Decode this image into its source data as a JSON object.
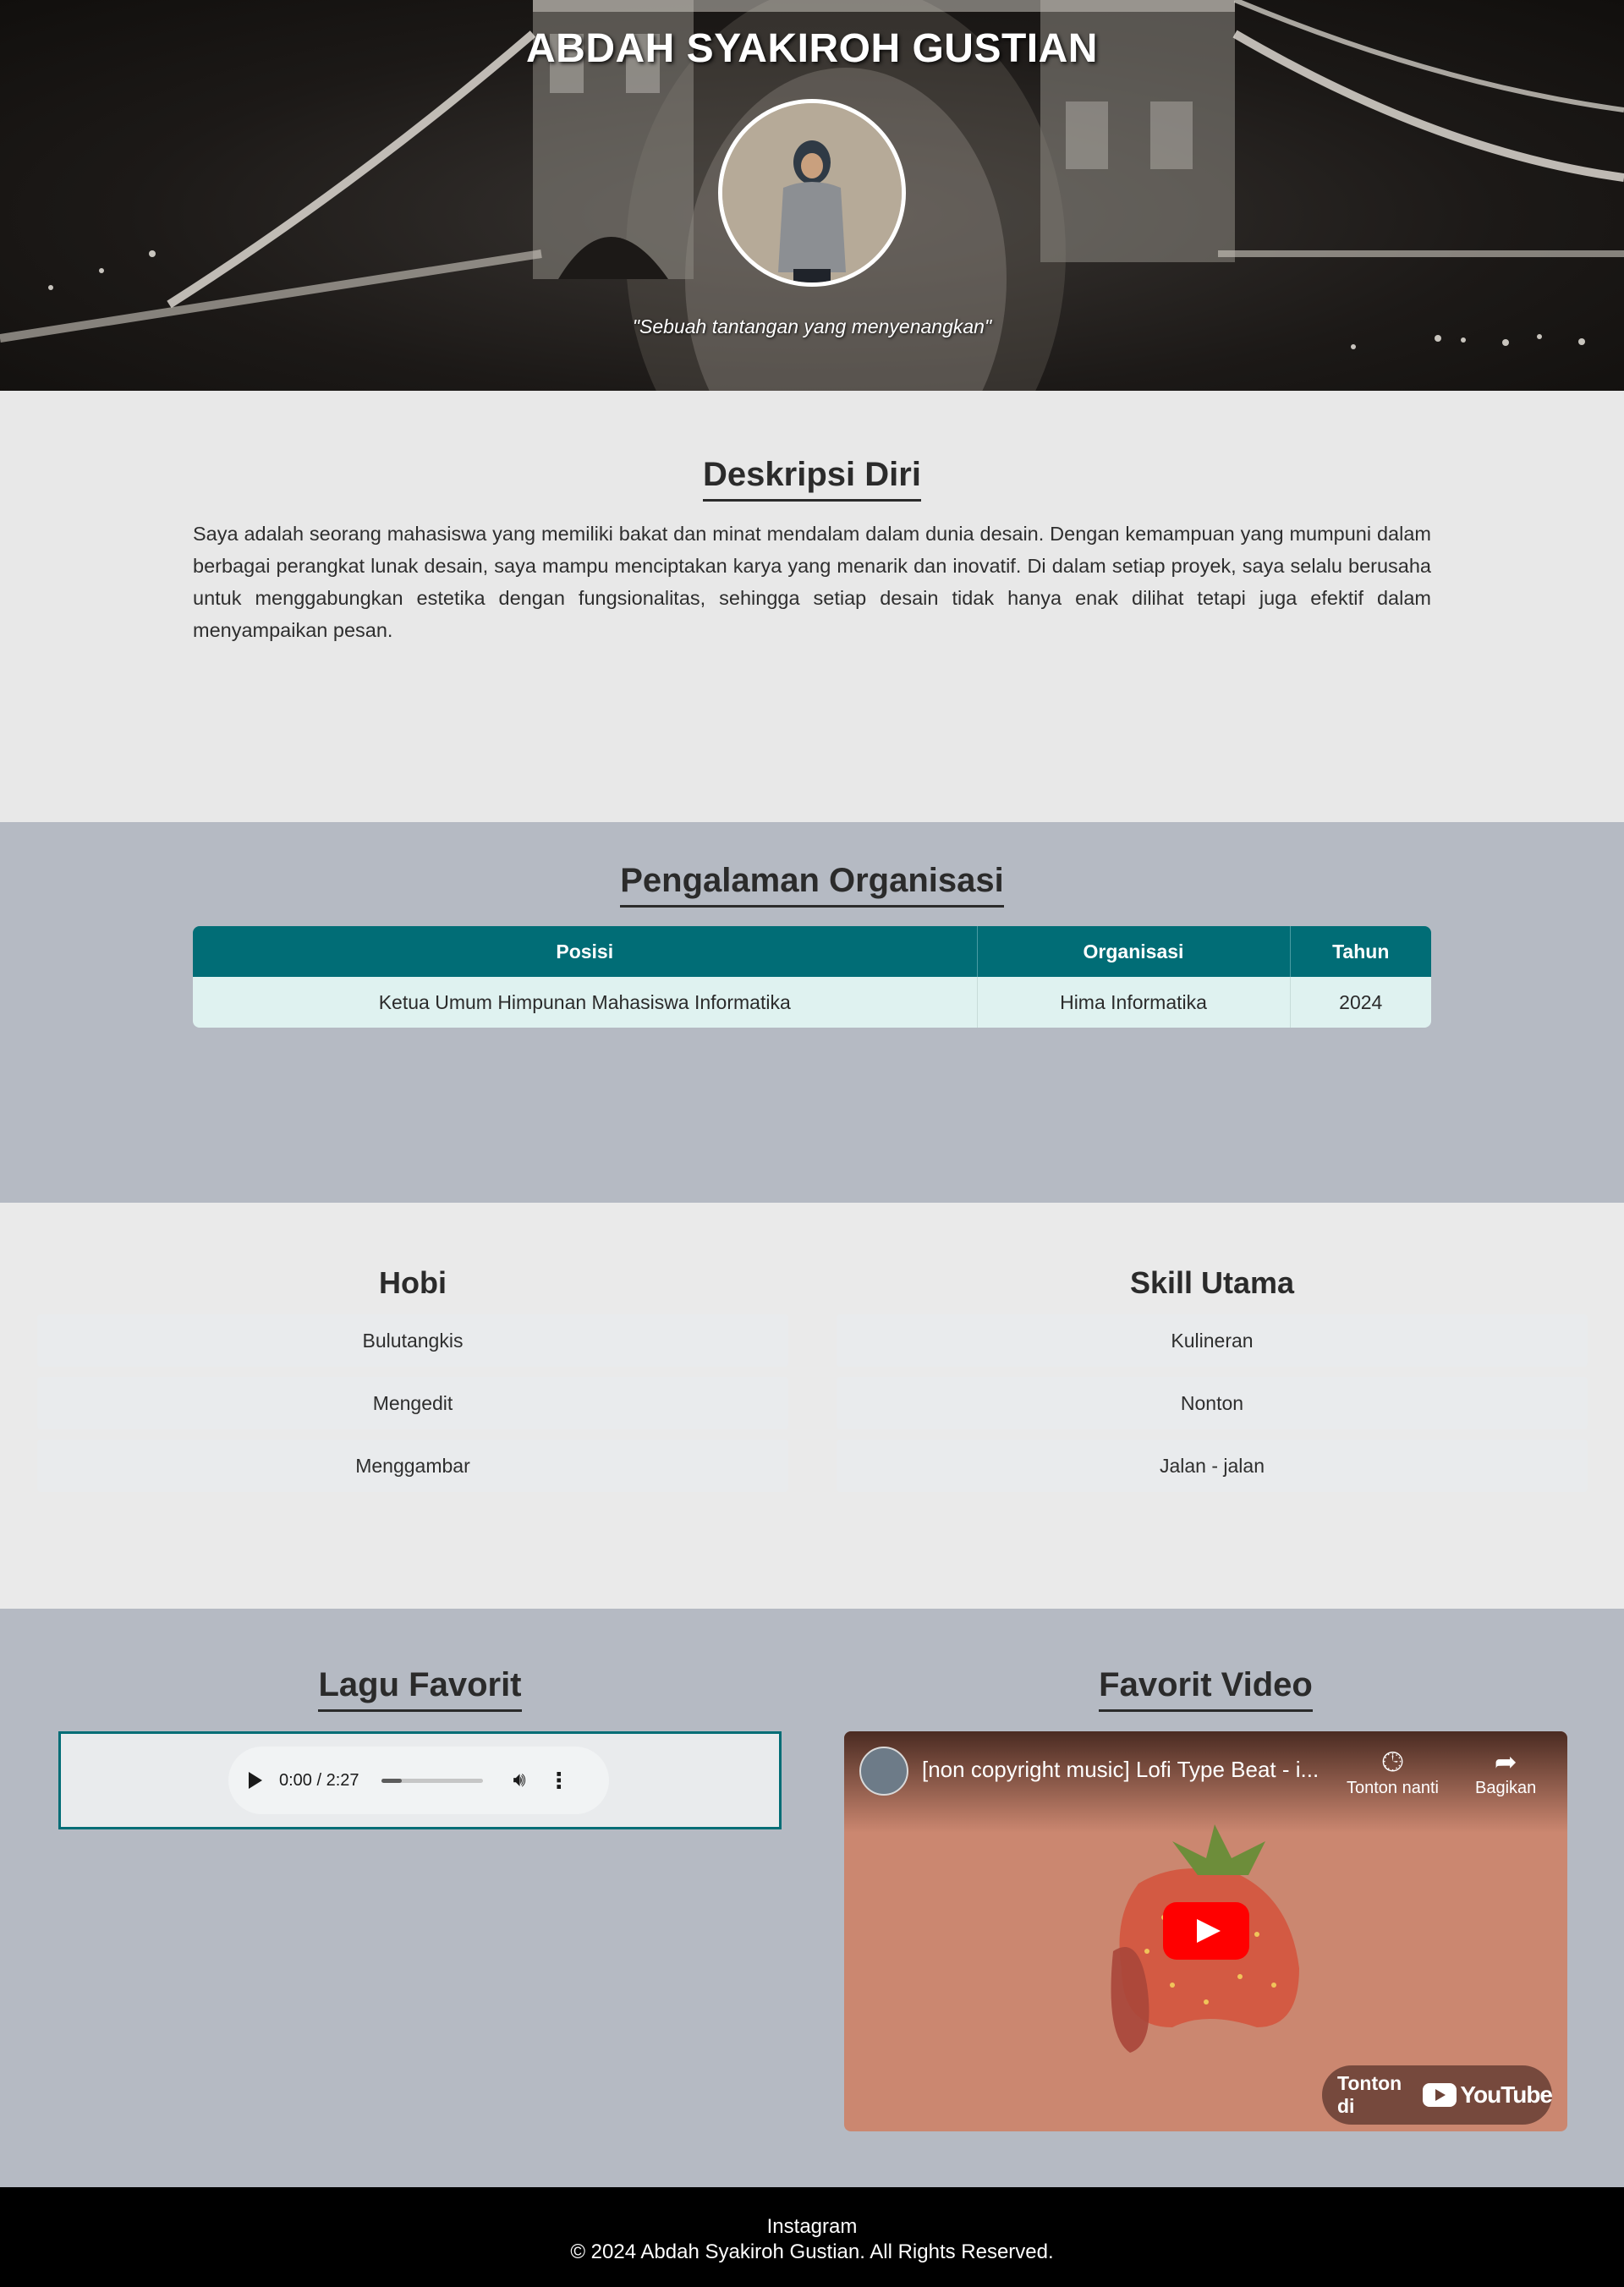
{
  "header": {
    "name": "ABDAH SYAKIROH GUSTIAN",
    "quote": "\"Sebuah tantangan yang menyenangkan\""
  },
  "description": {
    "title": "Deskripsi Diri",
    "text": "Saya adalah seorang mahasiswa yang memiliki bakat dan minat mendalam dalam dunia desain. Dengan kemampuan yang mumpuni dalam berbagai perangkat lunak desain, saya mampu menciptakan karya yang menarik dan inovatif. Di dalam setiap proyek, saya selalu berusaha untuk menggabungkan estetika dengan fungsionalitas, sehingga setiap desain tidak hanya enak dilihat tetapi juga efektif dalam menyampaikan pesan."
  },
  "organization": {
    "title": "Pengalaman Organisasi",
    "headers": [
      "Posisi",
      "Organisasi",
      "Tahun"
    ],
    "rows": [
      [
        "Ketua Umum Himpunan Mahasiswa Informatika",
        "Hima Informatika",
        "2024"
      ]
    ]
  },
  "hobbies": {
    "title": "Hobi",
    "items": [
      "Bulutangkis",
      "Mengedit",
      "Menggambar"
    ]
  },
  "skills": {
    "title": "Skill Utama",
    "items": [
      "Kulineran",
      "Nonton",
      "Jalan - jalan"
    ]
  },
  "music": {
    "title": "Lagu Favorit",
    "time": "0:00 / 2:27",
    "progress": 0.02
  },
  "video": {
    "section_title": "Favorit Video",
    "title": "[non copyright music] Lofi Type Beat - i...",
    "watch_later": "Tonton nanti",
    "share": "Bagikan",
    "watch_on": "Tonton di",
    "brand": "YouTube"
  },
  "footer": {
    "link": "Instagram",
    "copyright": "© 2024 Abdah Syakiroh Gustian. All Rights Reserved."
  },
  "colors": {
    "accent": "#016d76",
    "table_row": "#dff2f0",
    "section_gray": "#b5bac3",
    "section_light": "#e8e8e8"
  }
}
